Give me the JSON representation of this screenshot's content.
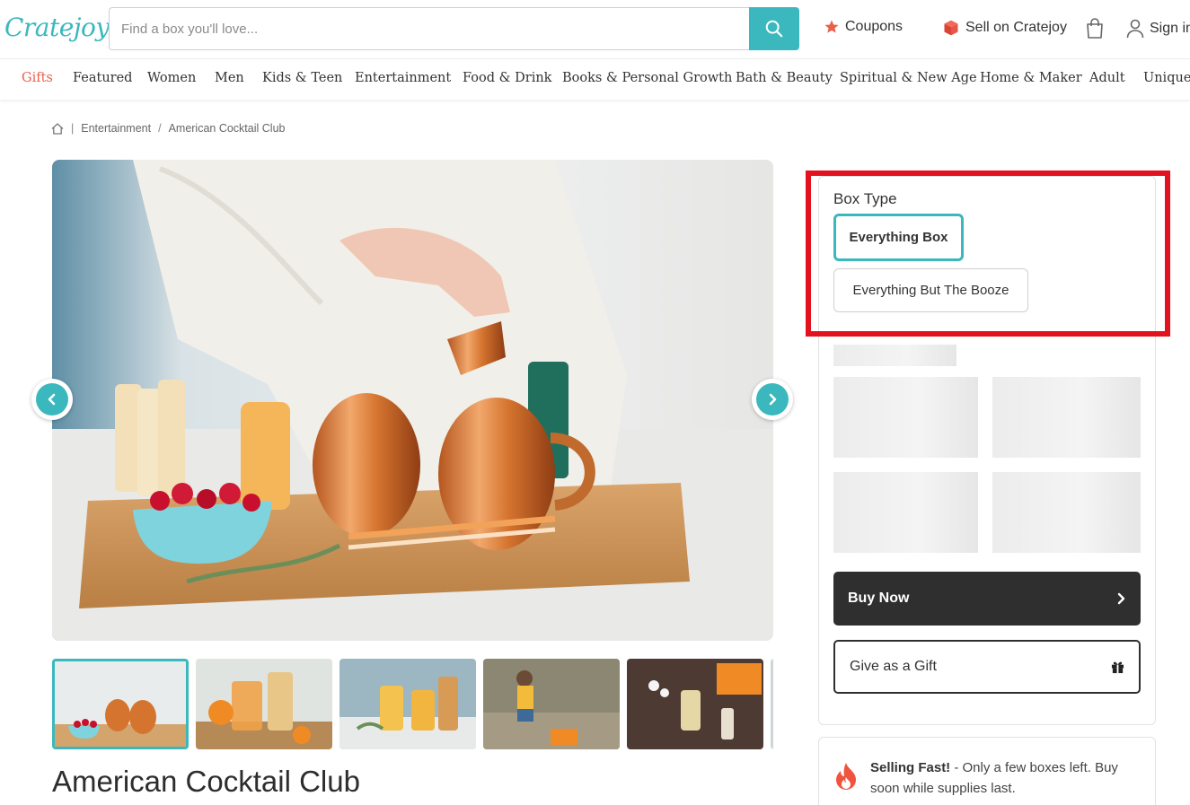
{
  "header": {
    "logo_text": "Cratejoy",
    "search_placeholder": "Find a box you'll love...",
    "coupons_label": "Coupons",
    "sell_label": "Sell on Cratejoy",
    "signin_label": "Sign in",
    "brand_color": "#3bb8bd",
    "coupon_star_color": "#e8604c"
  },
  "categories": [
    {
      "label": "Gifts",
      "active": true
    },
    {
      "label": "Featured"
    },
    {
      "label": "Women"
    },
    {
      "label": "Men"
    },
    {
      "label": "Kids & Teen"
    },
    {
      "label": "Entertainment"
    },
    {
      "label": "Food & Drink"
    },
    {
      "label": "Books & Personal Growth"
    },
    {
      "label": "Bath & Beauty"
    },
    {
      "label": "Spiritual & New Age"
    },
    {
      "label": "Home & Maker"
    },
    {
      "label": "Adult"
    },
    {
      "label": "Unique"
    }
  ],
  "breadcrumb": {
    "home_icon": "home-icon",
    "category": "Entertainment",
    "current": "American Cocktail Club"
  },
  "product": {
    "title": "American Cocktail Club"
  },
  "options": {
    "label": "Box Type",
    "items": [
      {
        "label": "Everything Box",
        "selected": true
      },
      {
        "label": "Everything But The Booze",
        "selected": false
      }
    ]
  },
  "actions": {
    "buy_label": "Buy Now",
    "gift_label": "Give as a Gift"
  },
  "notice": {
    "bold": "Selling Fast!",
    "text": " - Only a few boxes left. Buy soon while supplies last."
  }
}
